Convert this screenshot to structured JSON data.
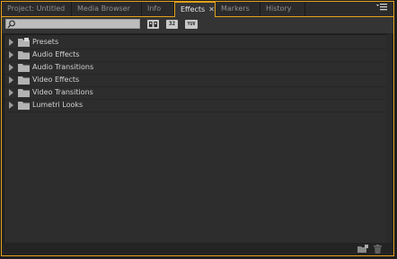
{
  "tabs": [
    {
      "label": "Project: Untitled",
      "active": false
    },
    {
      "label": "Media Browser",
      "active": false
    },
    {
      "label": "Info",
      "active": false
    },
    {
      "label": "Effects",
      "active": true
    },
    {
      "label": "Markers",
      "active": false
    },
    {
      "label": "History",
      "active": false
    }
  ],
  "toolbar": {
    "search_value": "",
    "btn_accelerated": "▣▣",
    "btn_32bit": "32",
    "btn_yuv": "YUV"
  },
  "effects": {
    "items": [
      {
        "label": "Presets",
        "icon": "preset-folder-icon"
      },
      {
        "label": "Audio Effects",
        "icon": "folder-icon"
      },
      {
        "label": "Audio Transitions",
        "icon": "folder-icon"
      },
      {
        "label": "Video Effects",
        "icon": "folder-icon"
      },
      {
        "label": "Video Transitions",
        "icon": "folder-icon"
      },
      {
        "label": "Lumetri Looks",
        "icon": "folder-icon"
      }
    ]
  },
  "colors": {
    "accent": "#e3a21a",
    "panel_bg": "#2d2d2d"
  }
}
